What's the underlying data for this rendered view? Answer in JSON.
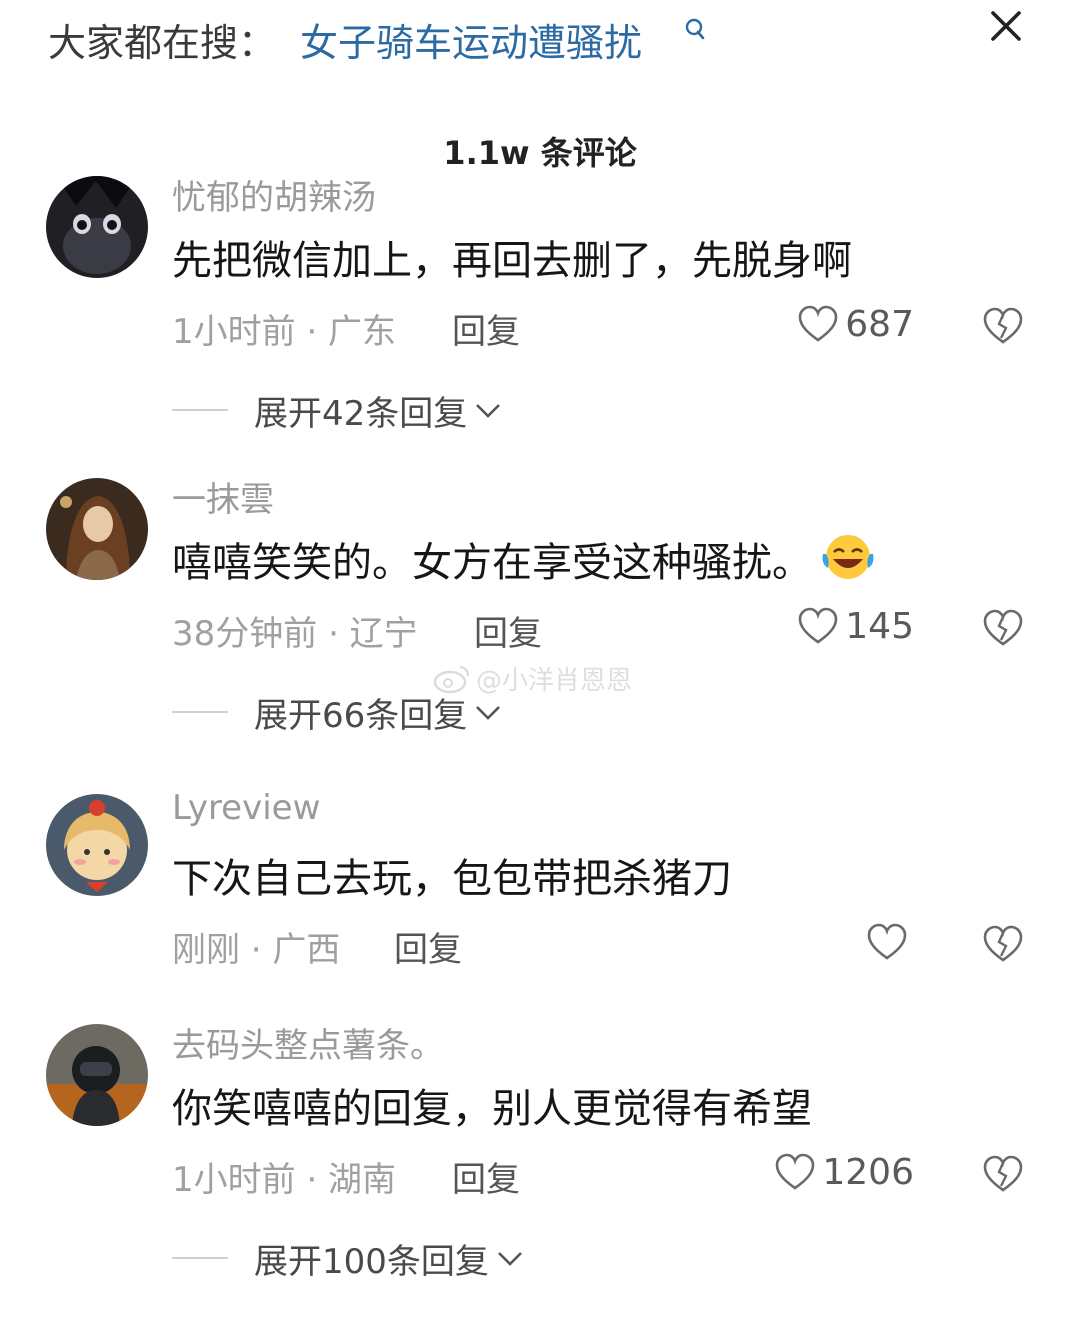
{
  "header": {
    "search_prefix": "大家都在搜：",
    "search_term": "女子骑车运动遭骚扰",
    "search_icon": "search-icon",
    "close_icon": "close-icon"
  },
  "comments_title": "1.1w 条评论",
  "comments": [
    {
      "username": "忧郁的胡辣汤",
      "text": "先把微信加上，再回去删了，先脱身啊",
      "meta": "1小时前 · 广东",
      "reply_label": "回复",
      "likes": "687",
      "expand_label": "展开42条回复"
    },
    {
      "username": "一抹雲",
      "text": "嘻嘻笑笑的。女方在享受这种骚扰。",
      "emoji": "laughing-with-tears-emoji",
      "meta": "38分钟前 · 辽宁",
      "reply_label": "回复",
      "likes": "145",
      "expand_label": "展开66条回复"
    },
    {
      "username": "Lyreview",
      "text": "下次自己去玩，包包带把杀猪刀",
      "meta": "刚刚 · 广西",
      "reply_label": "回复",
      "likes": ""
    },
    {
      "username": "去码头整点薯条。",
      "text": "你笑嘻嘻的回复，别人更觉得有希望",
      "meta": "1小时前 · 湖南",
      "reply_label": "回复",
      "likes": "1206",
      "expand_label": "展开100条回复"
    }
  ],
  "watermark": "@小洋肖恩恩",
  "colors": {
    "search_term": "#2c6aa3",
    "username": "#9a9a9a",
    "meta": "#a0a0a0",
    "text": "#161616"
  }
}
